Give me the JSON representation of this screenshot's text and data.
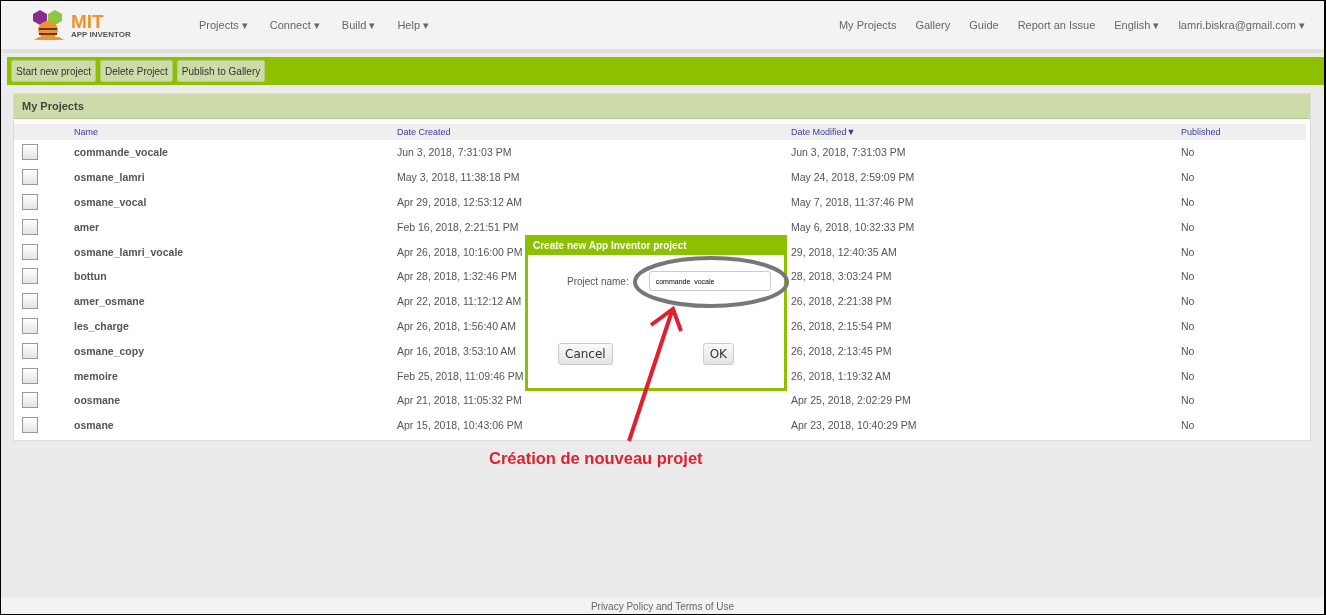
{
  "logo": {
    "title": "MIT",
    "subtitle": "APP INVENTOR"
  },
  "nav_menus": [
    {
      "label": "Projects"
    },
    {
      "label": "Connect"
    },
    {
      "label": "Build"
    },
    {
      "label": "Help"
    }
  ],
  "nav_links": [
    {
      "label": "My Projects",
      "dropdown": false
    },
    {
      "label": "Gallery",
      "dropdown": false
    },
    {
      "label": "Guide",
      "dropdown": false
    },
    {
      "label": "Report an Issue",
      "dropdown": false
    },
    {
      "label": "English",
      "dropdown": true
    },
    {
      "label": "lamri.biskra@gmail.com",
      "dropdown": true
    }
  ],
  "caret": "▾",
  "toolbar": [
    "Start new project",
    "Delete Project",
    "Publish to Gallery"
  ],
  "panel": {
    "title": "My Projects",
    "columns": [
      "Name",
      "Date Created",
      "Date Modified▼",
      "Published"
    ],
    "rows": [
      {
        "checked": false,
        "name": "commande_vocale",
        "created": "Jun 3, 2018, 7:31:03 PM",
        "modified": "Jun 3, 2018, 7:31:03 PM",
        "published": "No"
      },
      {
        "checked": false,
        "name": "osmane_lamri",
        "created": "May 3, 2018, 11:38:18 PM",
        "modified": "May 24, 2018, 2:59:09 PM",
        "published": "No"
      },
      {
        "checked": false,
        "name": "osmane_vocal",
        "created": "Apr 29, 2018, 12:53:12 AM",
        "modified": "May 7, 2018, 11:37:46 PM",
        "published": "No"
      },
      {
        "checked": false,
        "name": "amer",
        "created": "Feb 16, 2018, 2:21:51 PM",
        "modified": "May 6, 2018, 10:32:33 PM",
        "published": "No"
      },
      {
        "checked": false,
        "name": "osmane_lamri_vocale",
        "created": "Apr 26, 2018, 10:16:00 PM",
        "modified": "29, 2018, 12:40:35 AM",
        "published": "No"
      },
      {
        "checked": false,
        "name": "bottun",
        "created": "Apr 28, 2018, 1:32:46 PM",
        "modified": "28, 2018, 3:03:24 PM",
        "published": "No"
      },
      {
        "checked": false,
        "name": "amer_osmane",
        "created": "Apr 22, 2018, 11:12:12 AM",
        "modified": "26, 2018, 2:21:38 PM",
        "published": "No"
      },
      {
        "checked": false,
        "name": "les_charge",
        "created": "Apr 26, 2018, 1:56:40 AM",
        "modified": "26, 2018, 2:15:54 PM",
        "published": "No"
      },
      {
        "checked": false,
        "name": "osmane_copy",
        "created": "Apr 16, 2018, 3:53:10 AM",
        "modified": "26, 2018, 2:13:45 PM",
        "published": "No"
      },
      {
        "checked": false,
        "name": "memoire",
        "created": "Feb 25, 2018, 11:09:46 PM",
        "modified": "26, 2018, 1:19:32 AM",
        "published": "No"
      },
      {
        "checked": false,
        "name": "oosmane",
        "created": "Apr 21, 2018, 11:05:32 PM",
        "modified": "Apr 25, 2018, 2:02:29 PM",
        "published": "No"
      },
      {
        "checked": false,
        "name": "osmane",
        "created": "Apr 15, 2018, 10:43:06 PM",
        "modified": "Apr 23, 2018, 10:40:29 PM",
        "published": "No"
      }
    ]
  },
  "dialog": {
    "title": "Create new App Inventor project",
    "field_label": "Project name:",
    "value": "commande_vocale",
    "buttons": [
      "Cancel",
      "OK"
    ]
  },
  "annotation": {
    "caption": "Création de nouveau projet"
  },
  "footer": "Privacy Policy and Terms of Use"
}
